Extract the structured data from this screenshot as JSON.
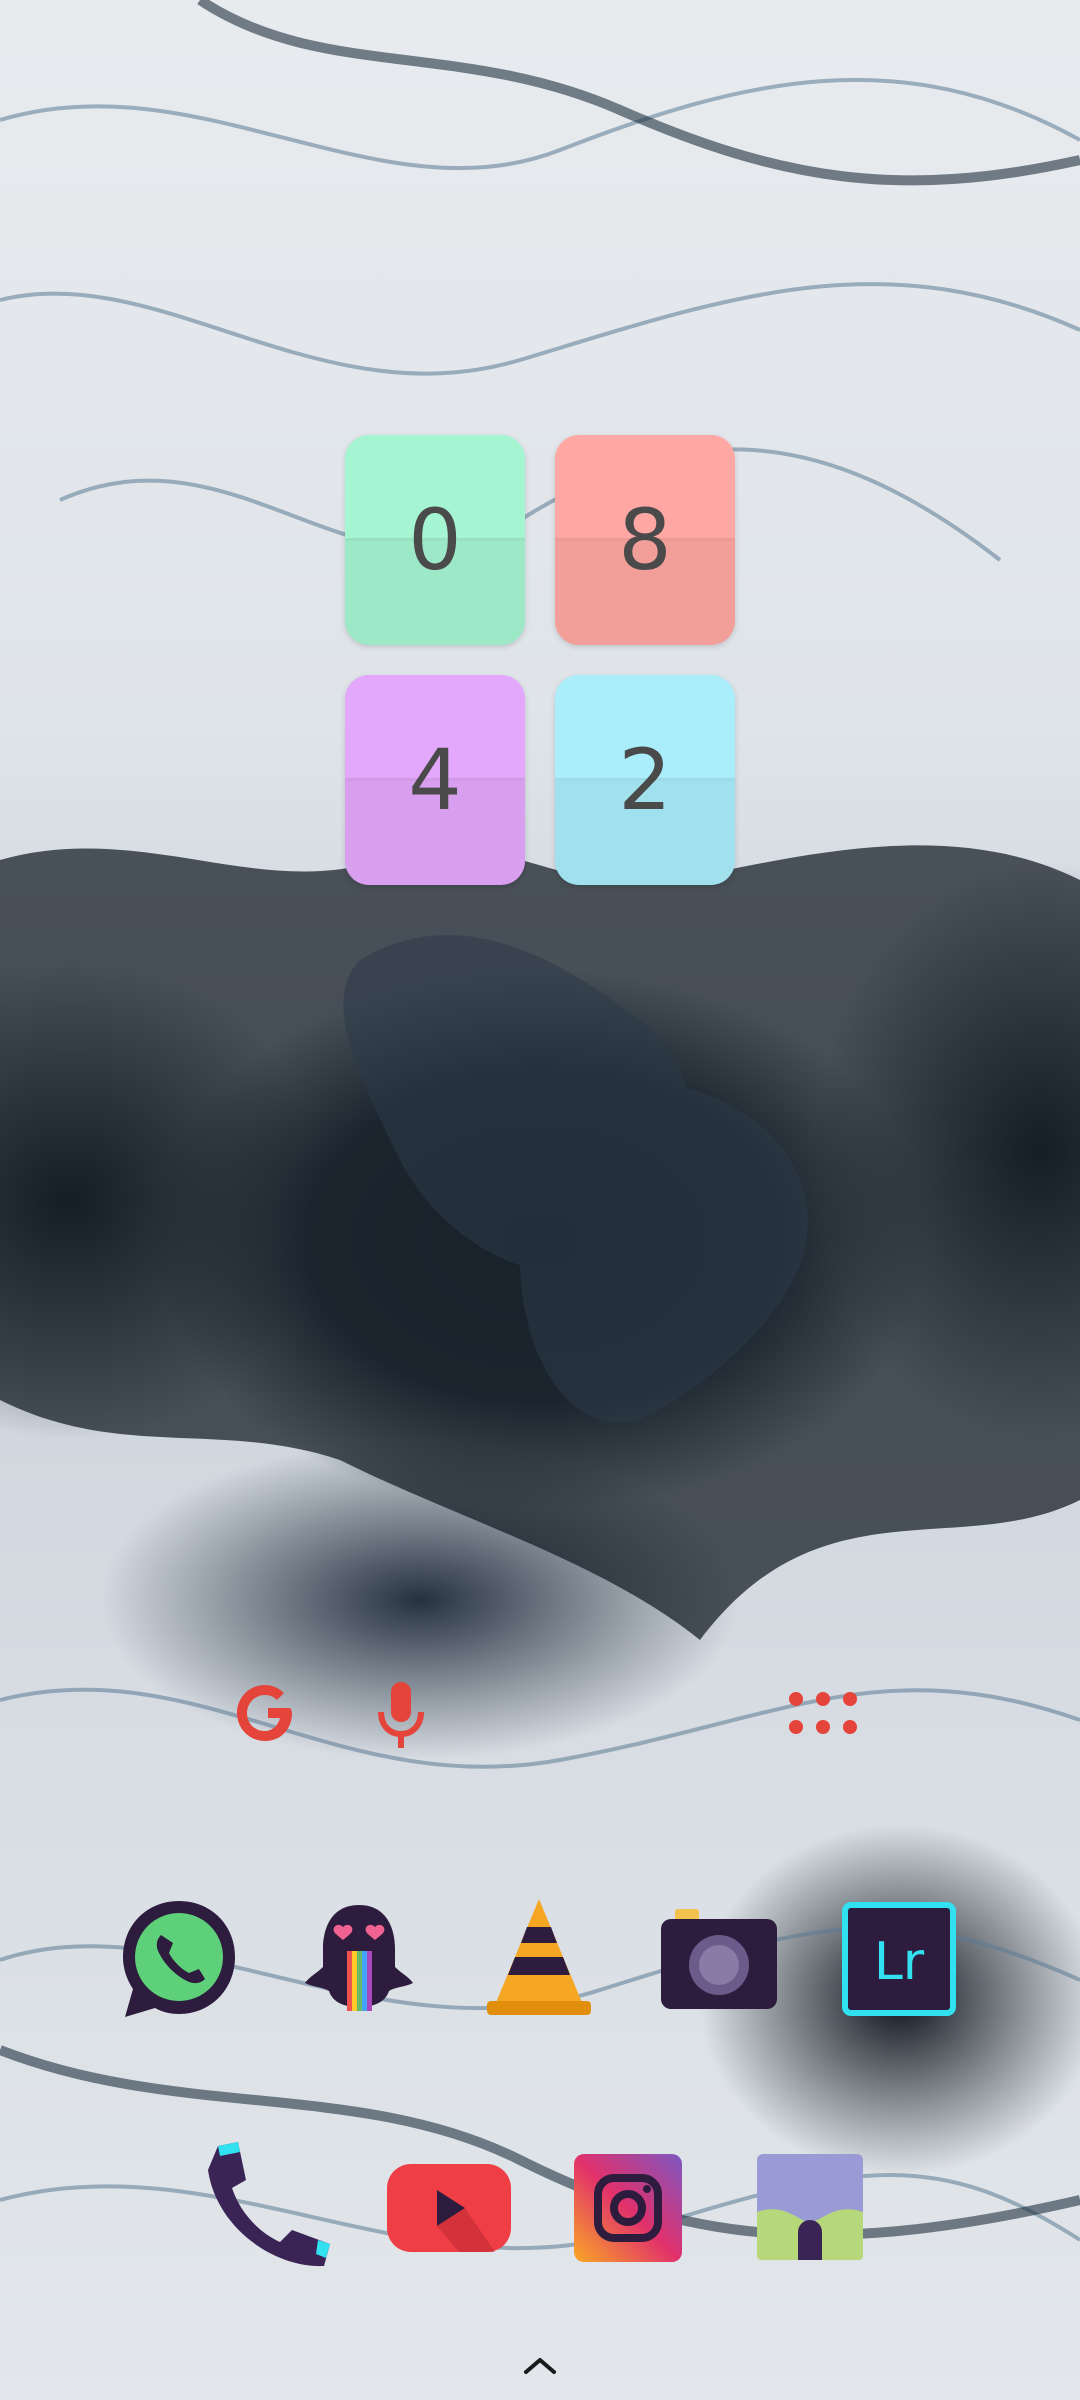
{
  "clock_widget": {
    "hour_tens": "0",
    "hour_ones": "8",
    "minute_tens": "4",
    "minute_ones": "2",
    "colors": {
      "hour_tens": "#a6f5d2",
      "hour_ones": "#ffa8a3",
      "minute_tens": "#e3a8fb",
      "minute_ones": "#aaeefb"
    }
  },
  "search_bar": {
    "google_icon": "google-g-icon",
    "mic_icon": "microphone-icon",
    "apps_icon": "app-drawer-dots-icon",
    "accent": "#e5443a"
  },
  "home_row": [
    {
      "name": "whatsapp",
      "icon": "whatsapp-icon"
    },
    {
      "name": "snapchat",
      "icon": "ghost-icon"
    },
    {
      "name": "vlc",
      "icon": "traffic-cone-icon"
    },
    {
      "name": "camera",
      "icon": "camera-icon"
    },
    {
      "name": "lightroom",
      "icon": "lightroom-icon"
    }
  ],
  "dock": [
    {
      "name": "phone",
      "icon": "phone-handset-icon"
    },
    {
      "name": "youtube",
      "icon": "youtube-play-icon"
    },
    {
      "name": "instagram",
      "icon": "instagram-icon"
    },
    {
      "name": "gallery",
      "icon": "gallery-landscape-icon"
    }
  ],
  "lightroom_text": "Lr",
  "nav": {
    "handle_icon": "chevron-up-icon"
  }
}
